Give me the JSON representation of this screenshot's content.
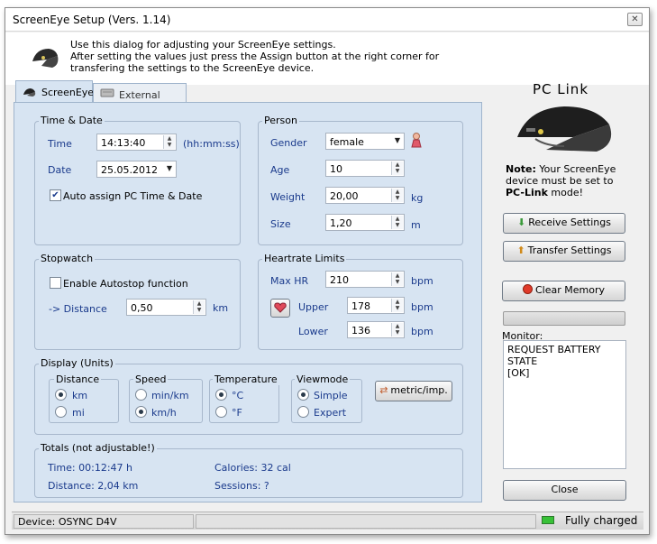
{
  "window": {
    "title": "ScreenEye Setup (Vers. 1.14)",
    "close_glyph": "✕"
  },
  "header": {
    "line1": "Use this dialog for adjusting your ScreenEye settings.",
    "line2": "After setting the values just press the Assign button at the right corner for transfering the settings to the ScreenEye device."
  },
  "tabs": [
    {
      "label": "ScreenEye",
      "active": true
    },
    {
      "label": "External pods",
      "active": false
    }
  ],
  "time_date": {
    "title": "Time & Date",
    "time_label": "Time",
    "time_value": "14:13:40",
    "time_unit": "(hh:mm:ss)",
    "date_label": "Date",
    "date_value": "25.05.2012",
    "auto_label": "Auto assign PC Time & Date",
    "auto_checked": true
  },
  "person": {
    "title": "Person",
    "gender_label": "Gender",
    "gender_value": "female",
    "age_label": "Age",
    "age_value": "10",
    "weight_label": "Weight",
    "weight_value": "20,00",
    "weight_unit": "kg",
    "size_label": "Size",
    "size_value": "1,20",
    "size_unit": "m"
  },
  "stopwatch": {
    "title": "Stopwatch",
    "autostop_label": "Enable Autostop function",
    "autostop_checked": false,
    "distance_label": "-> Distance",
    "distance_value": "0,50",
    "distance_unit": "km"
  },
  "heartrate": {
    "title": "Heartrate Limits",
    "max_label": "Max HR",
    "max_value": "210",
    "max_unit": "bpm",
    "upper_label": "Upper",
    "upper_value": "178",
    "upper_unit": "bpm",
    "lower_label": "Lower",
    "lower_value": "136",
    "lower_unit": "bpm"
  },
  "display": {
    "title": "Display (Units)",
    "distance": {
      "title": "Distance",
      "opt1": "km",
      "opt2": "mi",
      "selected": "km"
    },
    "speed": {
      "title": "Speed",
      "opt1": "min/km",
      "opt2": "km/h",
      "selected": "km/h"
    },
    "temperature": {
      "title": "Temperature",
      "opt1": "°C",
      "opt2": "°F",
      "selected": "°C"
    },
    "viewmode": {
      "title": "Viewmode",
      "opt1": "Simple",
      "opt2": "Expert",
      "selected": "Simple"
    },
    "metric_button": "metric/imp."
  },
  "totals": {
    "title": "Totals (not adjustable!)",
    "time": "Time: 00:12:47 h",
    "distance": "Distance: 2,04 km",
    "calories": "Calories: 32 cal",
    "sessions": "Sessions: ?"
  },
  "right": {
    "title": "PC  Link",
    "note_bold": "Note:",
    "note_text1": " Your ScreenEye device must be set to ",
    "note_bold2": "PC-Link",
    "note_text2": " mode!",
    "receive_button": "Receive Settings",
    "transfer_button": "Transfer Settings",
    "clear_button": "Clear Memory",
    "monitor_label": "Monitor:",
    "monitor_lines": [
      "REQUEST BATTERY",
      "STATE",
      "[OK]"
    ],
    "close_button": "Close"
  },
  "status": {
    "device": "Device: OSYNC D4V",
    "battery": "Fully charged"
  },
  "colors": {
    "panel": "#d7e4f2",
    "label_blue": "#1a3a8c",
    "battery_green": "#37c137"
  }
}
